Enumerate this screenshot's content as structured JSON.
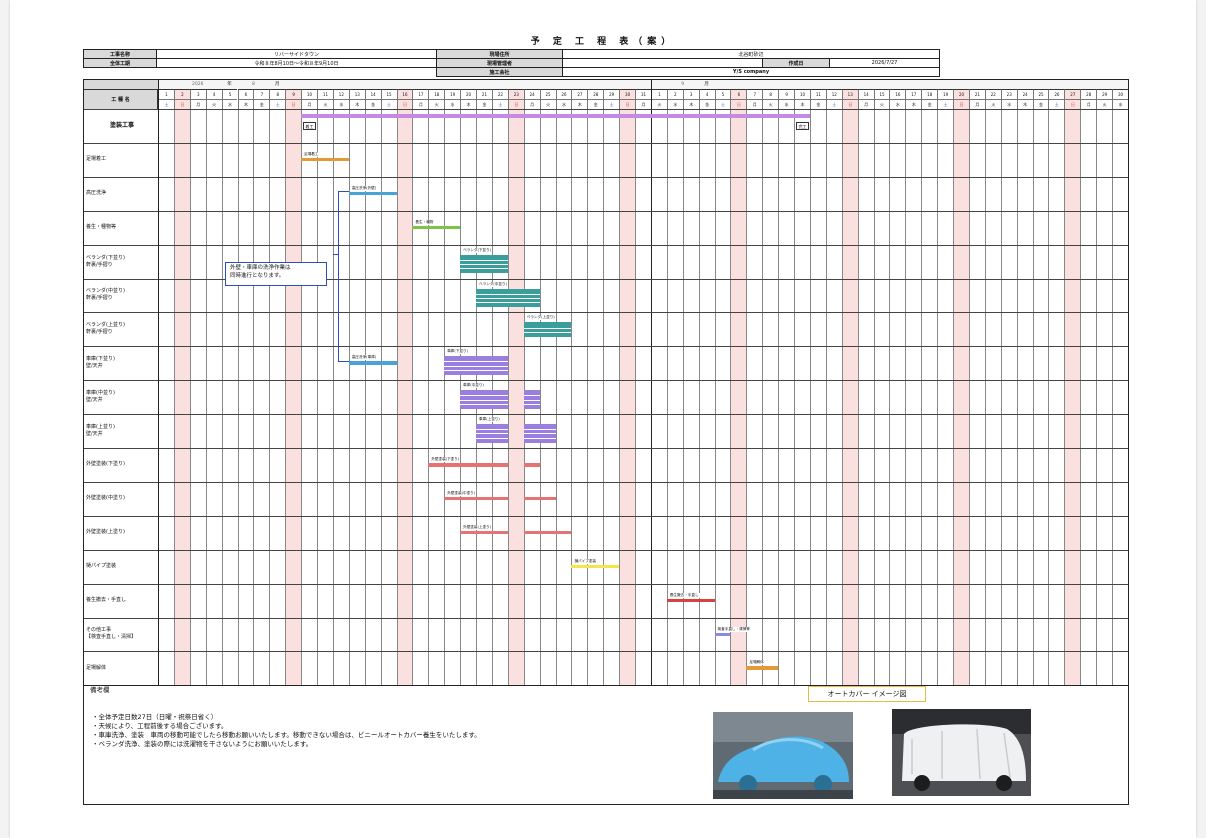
{
  "title": "予 定 工 程 表（案）",
  "header": {
    "project_name_label": "工事名称",
    "project_name": "リバーサイドタウン",
    "location_label": "現場住所",
    "location": "北谷町砂辺",
    "period_label": "全体工期",
    "period": "令和８年8月10日～令和８年9月10日",
    "manager_label": "現場管理者",
    "manager": "",
    "created_label": "作成日",
    "created": "2026/7/27",
    "contractor_label": "施工会社",
    "contractor": "Y/S company"
  },
  "calendar": {
    "year": "2026",
    "year_unit": "年",
    "month1": "8",
    "month2": "9",
    "month_unit": "月",
    "work_label": "工 種 名",
    "aug_days": [
      "1",
      "2",
      "3",
      "4",
      "5",
      "6",
      "7",
      "8",
      "9",
      "10",
      "11",
      "12",
      "13",
      "14",
      "15",
      "16",
      "17",
      "18",
      "19",
      "20",
      "21",
      "22",
      "23",
      "24",
      "25",
      "26",
      "27",
      "28",
      "29",
      "30",
      "31"
    ],
    "aug_weekdays": [
      "土",
      "日",
      "月",
      "火",
      "水",
      "木",
      "金",
      "土",
      "日",
      "月",
      "火",
      "水",
      "木",
      "金",
      "土",
      "日",
      "月",
      "火",
      "水",
      "木",
      "金",
      "土",
      "日",
      "月",
      "火",
      "水",
      "木",
      "金",
      "土",
      "日",
      "月"
    ],
    "sep_days": [
      "1",
      "2",
      "3",
      "4",
      "5",
      "6",
      "7",
      "8",
      "9",
      "10",
      "11",
      "12",
      "13",
      "14",
      "15",
      "16",
      "17",
      "18",
      "19",
      "20",
      "21",
      "22",
      "23",
      "24",
      "25",
      "26",
      "27",
      "28",
      "29",
      "30"
    ],
    "sep_weekdays": [
      "火",
      "水",
      "木",
      "金",
      "土",
      "日",
      "月",
      "火",
      "水",
      "木",
      "金",
      "土",
      "日",
      "月",
      "火",
      "水",
      "木",
      "金",
      "土",
      "日",
      "月",
      "火",
      "水",
      "木",
      "金",
      "土",
      "日",
      "月",
      "火",
      "水"
    ]
  },
  "rows": [
    {
      "label": "塗装工事",
      "bold": true
    },
    {
      "label": "足場着工"
    },
    {
      "label": "高圧洗浄"
    },
    {
      "label": "養生・種物等"
    },
    {
      "label": "ベランダ(下並り)\n軒裏/手摺り"
    },
    {
      "label": "ベランダ(中並り)\n軒裏/手摺り"
    },
    {
      "label": "ベランダ(上並り)\n軒裏/手摺り"
    },
    {
      "label": "車庫(下並り)\n壁/天井"
    },
    {
      "label": "車庫(中並り)\n壁/天井"
    },
    {
      "label": "車庫(上並り)\n壁/天井"
    },
    {
      "label": "外壁塗装(下塗り)"
    },
    {
      "label": "外壁塗装(中塗り)"
    },
    {
      "label": "外壁塗装(上塗り)"
    },
    {
      "label": "樋パイプ塗装"
    },
    {
      "label": "養生撤去・手直し"
    },
    {
      "label": "その他工事\n【検査手直し・清掃】"
    },
    {
      "label": "足場解体"
    }
  ],
  "bars": [
    {
      "row": 0,
      "start": 9,
      "end": 41,
      "color": "#c58be3",
      "label": ""
    },
    {
      "row": 1,
      "start": 9,
      "end": 12,
      "color": "#e59a3a",
      "label": "足場着工"
    },
    {
      "row": 2,
      "start": 12,
      "end": 15,
      "color": "#4aa3d8",
      "label": "高圧洗浄(外壁)"
    },
    {
      "row": 3,
      "start": 16,
      "end": 19,
      "color": "#7ec24a",
      "label": "養生・種物"
    },
    {
      "row": 4,
      "start": 19,
      "end": 22,
      "color": "#3a9e9c",
      "label": "ベランダ(下並り)",
      "stack": 4
    },
    {
      "row": 5,
      "start": 20,
      "end": 23,
      "color": "#3a9e9c",
      "label": "ベランダ(中並り)",
      "stack": 4
    },
    {
      "row": 5,
      "start": 23,
      "end": 24,
      "color": "#3a9e9c",
      "label": "",
      "stack": 4
    },
    {
      "row": 6,
      "start": 23,
      "end": 26,
      "color": "#3a9e9c",
      "label": "ベランダ(上並り)",
      "stack": 3
    },
    {
      "row": 7,
      "start": 12,
      "end": 15,
      "color": "#4aa3d8",
      "label": "高圧洗浄(車庫)"
    },
    {
      "row": 7,
      "start": 18,
      "end": 22,
      "color": "#9b7fe0",
      "label": "車庫(下並り)",
      "stack": 4
    },
    {
      "row": 8,
      "start": 19,
      "end": 22,
      "color": "#9b7fe0",
      "label": "車庫(中並り)",
      "stack": 4
    },
    {
      "row": 8,
      "start": 23,
      "end": 24,
      "color": "#9b7fe0",
      "label": "",
      "stack": 4
    },
    {
      "row": 9,
      "start": 20,
      "end": 22,
      "color": "#9b7fe0",
      "label": "車庫(上並り)",
      "stack": 4
    },
    {
      "row": 9,
      "start": 23,
      "end": 25,
      "color": "#9b7fe0",
      "label": "",
      "stack": 4
    },
    {
      "row": 10,
      "start": 17,
      "end": 22,
      "color": "#e57373",
      "label": "外壁塗装(下塗り)"
    },
    {
      "row": 10,
      "start": 23,
      "end": 24,
      "color": "#e57373",
      "label": ""
    },
    {
      "row": 11,
      "start": 18,
      "end": 22,
      "color": "#e57373",
      "label": "外壁塗装(中塗り)"
    },
    {
      "row": 11,
      "start": 23,
      "end": 25,
      "color": "#e57373",
      "label": ""
    },
    {
      "row": 12,
      "start": 19,
      "end": 22,
      "color": "#e57373",
      "label": "外壁塗装(上塗り)"
    },
    {
      "row": 12,
      "start": 23,
      "end": 26,
      "color": "#e57373",
      "label": ""
    },
    {
      "row": 13,
      "start": 26,
      "end": 29,
      "color": "#f2e64a",
      "label": "樋パイプ塗装"
    },
    {
      "row": 14,
      "start": 32,
      "end": 35,
      "color": "#d94040",
      "label": "養生撤去・手直し"
    },
    {
      "row": 15,
      "start": 35,
      "end": 36,
      "color": "#8a8ae0",
      "label": "検査手直し・清掃等"
    },
    {
      "row": 16,
      "start": 37,
      "end": 39,
      "color": "#e59a3a",
      "label": "足場解体"
    }
  ],
  "tags": {
    "start": "着工",
    "end": "完工"
  },
  "callout": "外壁・車庫の洗浄作業は\n同時進行となります。",
  "notes": {
    "heading": "備考欄",
    "lines": [
      "・全体予定日数27日（日曜・祝祭日省く）",
      "・天候により、工程前後する場合ございます。",
      "・車庫洗浄、塗装　車両の移動可能でしたら移動お願いいたします。移動できない場合は、ビニールオートカバー養生をいたします。",
      "・ベランダ洗浄、塗装の際には洗濯物を干さないようにお願いいたします。"
    ],
    "image_caption": "オートカバー イメージ図"
  },
  "colors": {
    "holiday": "#fbe0e0",
    "grid": "#333",
    "header": "#d9d9d9"
  }
}
